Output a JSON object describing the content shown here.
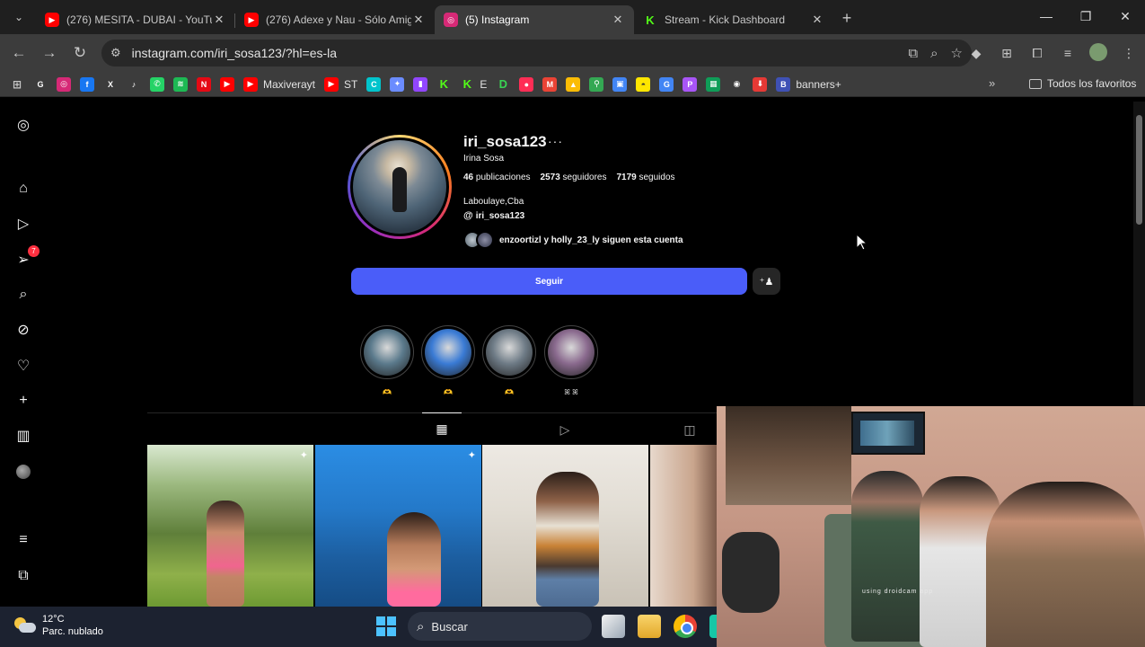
{
  "tabs": [
    {
      "title": "(276) MESITA - DUBAI - YouTube",
      "favicon": "youtube-icon",
      "color": "#ff0000",
      "active": false
    },
    {
      "title": "(276) Adexe y Nau - Sólo Amigos",
      "favicon": "youtube-icon",
      "color": "#ff0000",
      "active": false
    },
    {
      "title": "(5) Instagram",
      "favicon": "instagram-icon",
      "color": "#d62976",
      "active": true
    },
    {
      "title": "Stream - Kick Dashboard",
      "favicon": "kick-icon",
      "color": "#53fc18",
      "active": false
    }
  ],
  "url": "instagram.com/iri_sosa123/?hl=es-la",
  "bookmarks": [
    {
      "icon": "google-icon",
      "label": "",
      "color": "#ffffff"
    },
    {
      "icon": "instagram-icon",
      "label": "",
      "color": "#d62976"
    },
    {
      "icon": "facebook-icon",
      "label": "",
      "color": "#1877f2"
    },
    {
      "icon": "x-icon",
      "label": "",
      "color": "#000000"
    },
    {
      "icon": "tiktok-icon",
      "label": "",
      "color": "#000000"
    },
    {
      "icon": "whatsapp-icon",
      "label": "",
      "color": "#25d366"
    },
    {
      "icon": "spotify-icon",
      "label": "",
      "color": "#1db954"
    },
    {
      "icon": "netflix-icon",
      "label": "",
      "color": "#e50914"
    },
    {
      "icon": "youtube-icon",
      "label": "",
      "color": "#ff0000"
    },
    {
      "icon": "youtube-icon",
      "label": "Maxiverayt",
      "color": "#ff0000"
    },
    {
      "icon": "youtube-icon",
      "label": "ST",
      "color": "#ff0000"
    },
    {
      "icon": "canva-icon",
      "label": "",
      "color": "#00c4cc"
    },
    {
      "icon": "gemini-icon",
      "label": "",
      "color": "#6b8cff"
    },
    {
      "icon": "twitch-icon",
      "label": "",
      "color": "#9146ff"
    },
    {
      "icon": "kick-icon",
      "label": "",
      "color": "#53fc18"
    },
    {
      "icon": "kick-icon",
      "label": "E",
      "color": "#53fc18"
    },
    {
      "icon": "d-icon",
      "label": "",
      "color": "#39d353"
    },
    {
      "icon": "music-icon",
      "label": "",
      "color": "#ff2d55"
    },
    {
      "icon": "gmail-icon",
      "label": "",
      "color": "#ea4335"
    },
    {
      "icon": "drive-icon",
      "label": "",
      "color": "#fbbc05"
    },
    {
      "icon": "maps-icon",
      "label": "",
      "color": "#34a853"
    },
    {
      "icon": "store-icon",
      "label": "",
      "color": "#4285f4"
    },
    {
      "icon": "mercado-icon",
      "label": "",
      "color": "#ffe600"
    },
    {
      "icon": "translate-icon",
      "label": "",
      "color": "#4285f4"
    },
    {
      "icon": "p-icon",
      "label": "",
      "color": "#a855f7"
    },
    {
      "icon": "sheets-icon",
      "label": "",
      "color": "#0f9d58"
    },
    {
      "icon": "podcast-icon",
      "label": "",
      "color": "#ffffff"
    },
    {
      "icon": "download-icon",
      "label": "",
      "color": "#e53935"
    },
    {
      "icon": "banners-icon",
      "label": "banners+",
      "color": "#3f51b5"
    }
  ],
  "all_bookmarks_label": "Todos los favoritos",
  "sidebar": {
    "notifications_badge": "7"
  },
  "profile": {
    "username": "iri_sosa123",
    "full_name": "Irina Sosa",
    "posts_count": "46",
    "posts_label": "publicaciones",
    "followers_count": "2573",
    "followers_label": "seguidores",
    "following_count": "7179",
    "following_label": "seguidos",
    "location": "Laboulaye,Cba",
    "threads_handle": "iri_sosa123",
    "followed_by": "enzoortizl y holly_23_ly siguen esta cuenta",
    "follow_button": "Seguir"
  },
  "highlights": [
    {
      "label": "🫶",
      "color": "#5b7a8c"
    },
    {
      "label": "🫶",
      "color": "#3a7bd5"
    },
    {
      "label": "🫶",
      "color": "#6e7b86"
    },
    {
      "label": "ꕤ ꕤ",
      "color": "#8a6a8e"
    }
  ],
  "taskbar": {
    "temperature": "12°C",
    "condition": "Parc. nublado",
    "search_placeholder": "Buscar"
  },
  "webcam": {
    "overlay_text": "using droidcam app"
  }
}
